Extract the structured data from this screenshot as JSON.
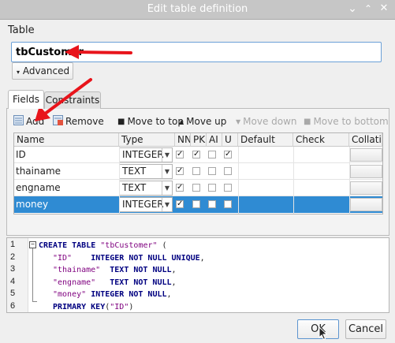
{
  "window": {
    "title": "Edit table definition"
  },
  "table_section": {
    "label": "Table",
    "name_value": "tbCustomer",
    "advanced_label": "Advanced"
  },
  "tabs": [
    {
      "label": "Fields",
      "active": true
    },
    {
      "label": "Constraints",
      "active": false
    }
  ],
  "toolbar": {
    "add": "Add",
    "remove": "Remove",
    "move_to_top": "Move to top",
    "move_up": "Move up",
    "move_down": "Move down",
    "move_to_bottom": "Move to bottom"
  },
  "grid": {
    "columns": [
      "Name",
      "Type",
      "NN",
      "PK",
      "AI",
      "U",
      "Default",
      "Check",
      "Collation"
    ],
    "rows": [
      {
        "name": "ID",
        "type": "INTEGER",
        "nn": true,
        "pk": true,
        "ai": false,
        "u": true,
        "selected": false
      },
      {
        "name": "thainame",
        "type": "TEXT",
        "nn": true,
        "pk": false,
        "ai": false,
        "u": false,
        "selected": false
      },
      {
        "name": "engname",
        "type": "TEXT",
        "nn": true,
        "pk": false,
        "ai": false,
        "u": false,
        "selected": false
      },
      {
        "name": "money",
        "type": "INTEGER",
        "nn": true,
        "pk": false,
        "ai": false,
        "u": false,
        "selected": true
      }
    ]
  },
  "sql": {
    "line_numbers": [
      "1",
      "2",
      "3",
      "4",
      "5",
      "6"
    ],
    "l1_kw": "CREATE TABLE",
    "l1_str": "\"tbCustomer\"",
    "l1_rest": " (",
    "l2_str": "\"ID\"",
    "l2_kw": "INTEGER NOT NULL UNIQUE",
    "l2_rest": ",",
    "l3_str": "\"thainame\"",
    "l3_kw": "TEXT NOT NULL",
    "l3_rest": ",",
    "l4_str": "\"engname\"",
    "l4_kw": "TEXT NOT NULL",
    "l4_rest": ",",
    "l5_str": "\"money\"",
    "l5_kw": "INTEGER NOT NULL",
    "l5_rest": ",",
    "l6_kw": "PRIMARY KEY",
    "l6_open": "(",
    "l6_str": "\"ID\"",
    "l6_close": ")"
  },
  "footer": {
    "ok": "OK",
    "cancel": "Cancel"
  },
  "colors": {
    "selection": "#2f8bd3",
    "arrow": "#e8141b",
    "keyword": "#000080",
    "string": "#7f007f"
  },
  "icons": [
    "minimize-icon",
    "maximize-icon",
    "close-icon",
    "chevron-down-icon",
    "add-field-icon",
    "remove-field-icon",
    "move-to-top-icon",
    "move-up-icon",
    "move-down-icon",
    "move-to-bottom-icon",
    "fold-toggle-icon",
    "mouse-cursor-icon",
    "annotation-arrow"
  ]
}
